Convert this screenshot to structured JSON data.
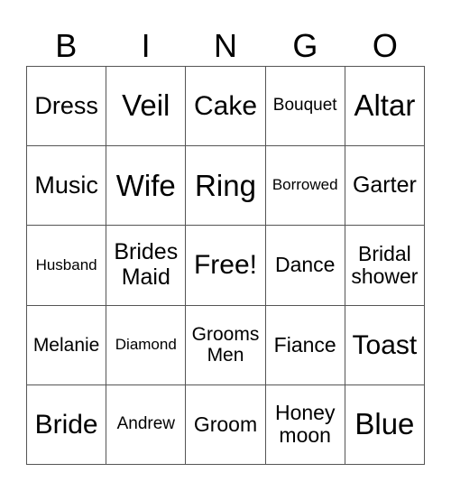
{
  "header": {
    "letters": [
      "B",
      "I",
      "N",
      "G",
      "O"
    ]
  },
  "board": {
    "rows": [
      [
        "Dress",
        "Veil",
        "Cake",
        "Bouquet",
        "Altar"
      ],
      [
        "Music",
        "Wife",
        "Ring",
        "Borrowed",
        "Garter"
      ],
      [
        "Husband",
        "Brides Maid",
        "Free!",
        "Dance",
        "Bridal shower"
      ],
      [
        "Melanie",
        "Diamond",
        "Grooms Men",
        "Fiance",
        "Toast"
      ],
      [
        "Bride",
        "Andrew",
        "Groom",
        "Honey moon",
        "Blue"
      ]
    ]
  }
}
